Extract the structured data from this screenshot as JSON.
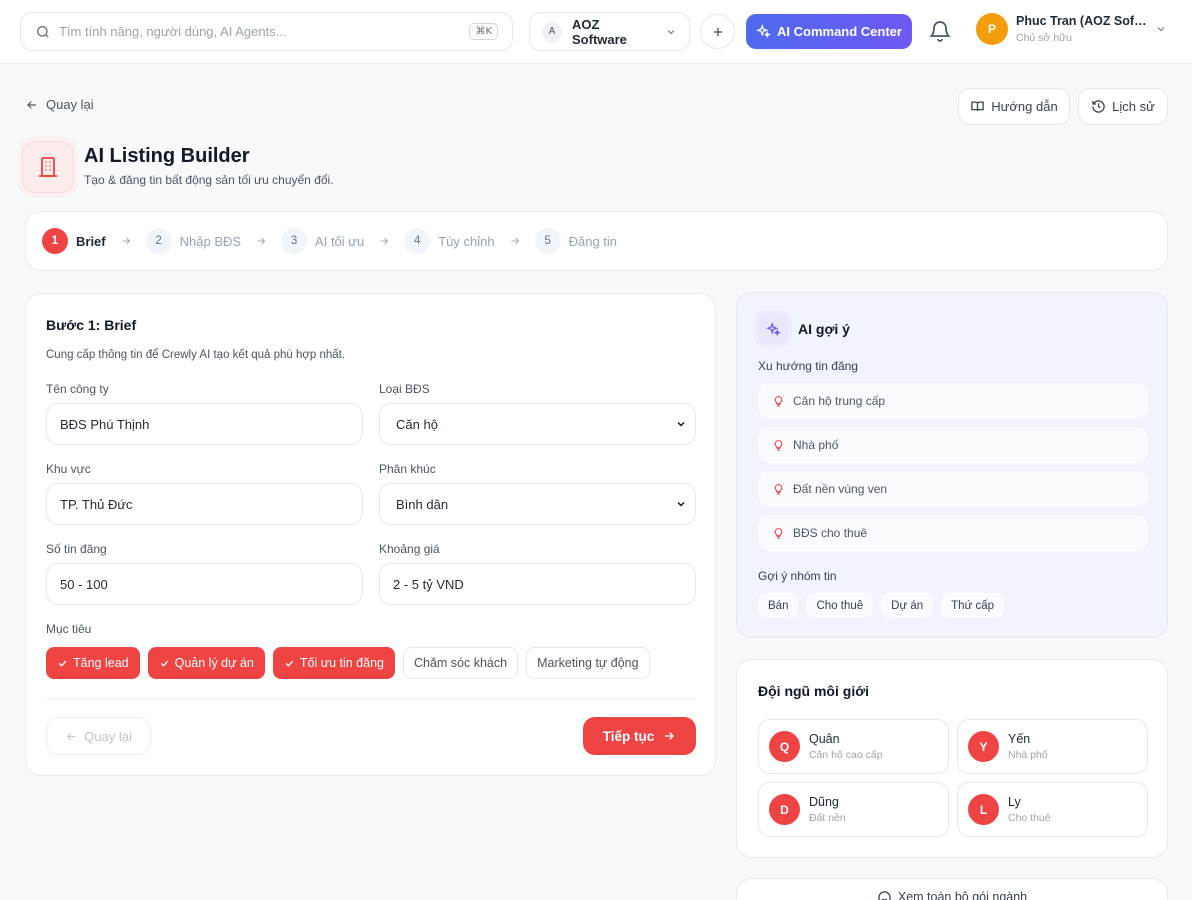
{
  "topbar": {
    "search_placeholder": "Tìm tính năng, người dùng, AI Agents...",
    "shortcut": "⌘K",
    "workspace_initial": "A",
    "workspace_name": "AOZ Software",
    "ai_command_label": "AI Command Center",
    "user_initial": "P",
    "user_name": "Phuc Tran (AOZ Software)",
    "user_role": "Chủ sở hữu"
  },
  "header": {
    "back_label": "Quay lại",
    "guide_label": "Hướng dẫn",
    "history_label": "Lịch sử",
    "title": "AI Listing Builder",
    "subtitle": "Tạo & đăng tin bất động sản tối ưu chuyển đổi."
  },
  "stepper": [
    {
      "num": "1",
      "label": "Brief",
      "active": true
    },
    {
      "num": "2",
      "label": "Nhập BĐS",
      "active": false
    },
    {
      "num": "3",
      "label": "AI tối ưu",
      "active": false
    },
    {
      "num": "4",
      "label": "Tùy chỉnh",
      "active": false
    },
    {
      "num": "5",
      "label": "Đăng tin",
      "active": false
    }
  ],
  "form": {
    "title": "Bước 1: Brief",
    "description": "Cung cấp thông tin để Crewly AI tạo kết quả phù hợp nhất.",
    "company_label": "Tên công ty",
    "company_value": "BĐS Phú Thịnh",
    "type_label": "Loại BĐS",
    "type_value": "Căn hộ",
    "area_label": "Khu vực",
    "area_value": "TP. Thủ Đức",
    "segment_label": "Phân khúc",
    "segment_value": "Bình dân",
    "count_label": "Số tin đăng",
    "count_value": "50 - 100",
    "price_label": "Khoảng giá",
    "price_value": "2 - 5 tỷ VND",
    "goals_label": "Mục tiêu",
    "goals": [
      {
        "label": "Tăng lead",
        "selected": true
      },
      {
        "label": "Quản lý dự án",
        "selected": true
      },
      {
        "label": "Tối ưu tin đăng",
        "selected": true
      },
      {
        "label": "Chăm sóc khách",
        "selected": false
      },
      {
        "label": "Marketing tự động",
        "selected": false
      }
    ],
    "back_label": "Quay lại",
    "next_label": "Tiếp tục"
  },
  "ai_suggest": {
    "title": "AI gợi ý",
    "trends_label": "Xu hướng tin đăng",
    "trends": [
      "Căn hộ trung cấp",
      "Nhà phố",
      "Đất nền vùng ven",
      "BĐS cho thuê"
    ],
    "groups_label": "Gợi ý nhóm tin",
    "groups": [
      "Bán",
      "Cho thuê",
      "Dự án",
      "Thứ cấp"
    ]
  },
  "team": {
    "title": "Đội ngũ môi giới",
    "members": [
      {
        "initial": "Q",
        "name": "Quân",
        "role": "Căn hộ cao cấp"
      },
      {
        "initial": "Y",
        "name": "Yến",
        "role": "Nhà phố"
      },
      {
        "initial": "D",
        "name": "Dũng",
        "role": "Đất nền"
      },
      {
        "initial": "L",
        "name": "Ly",
        "role": "Cho thuê"
      }
    ]
  },
  "more_label": "Xem toàn bộ gói ngành",
  "colors": {
    "accent": "#ef4444",
    "ai_gradient_start": "#4f6bf0",
    "ai_gradient_end": "#6f58f3"
  }
}
